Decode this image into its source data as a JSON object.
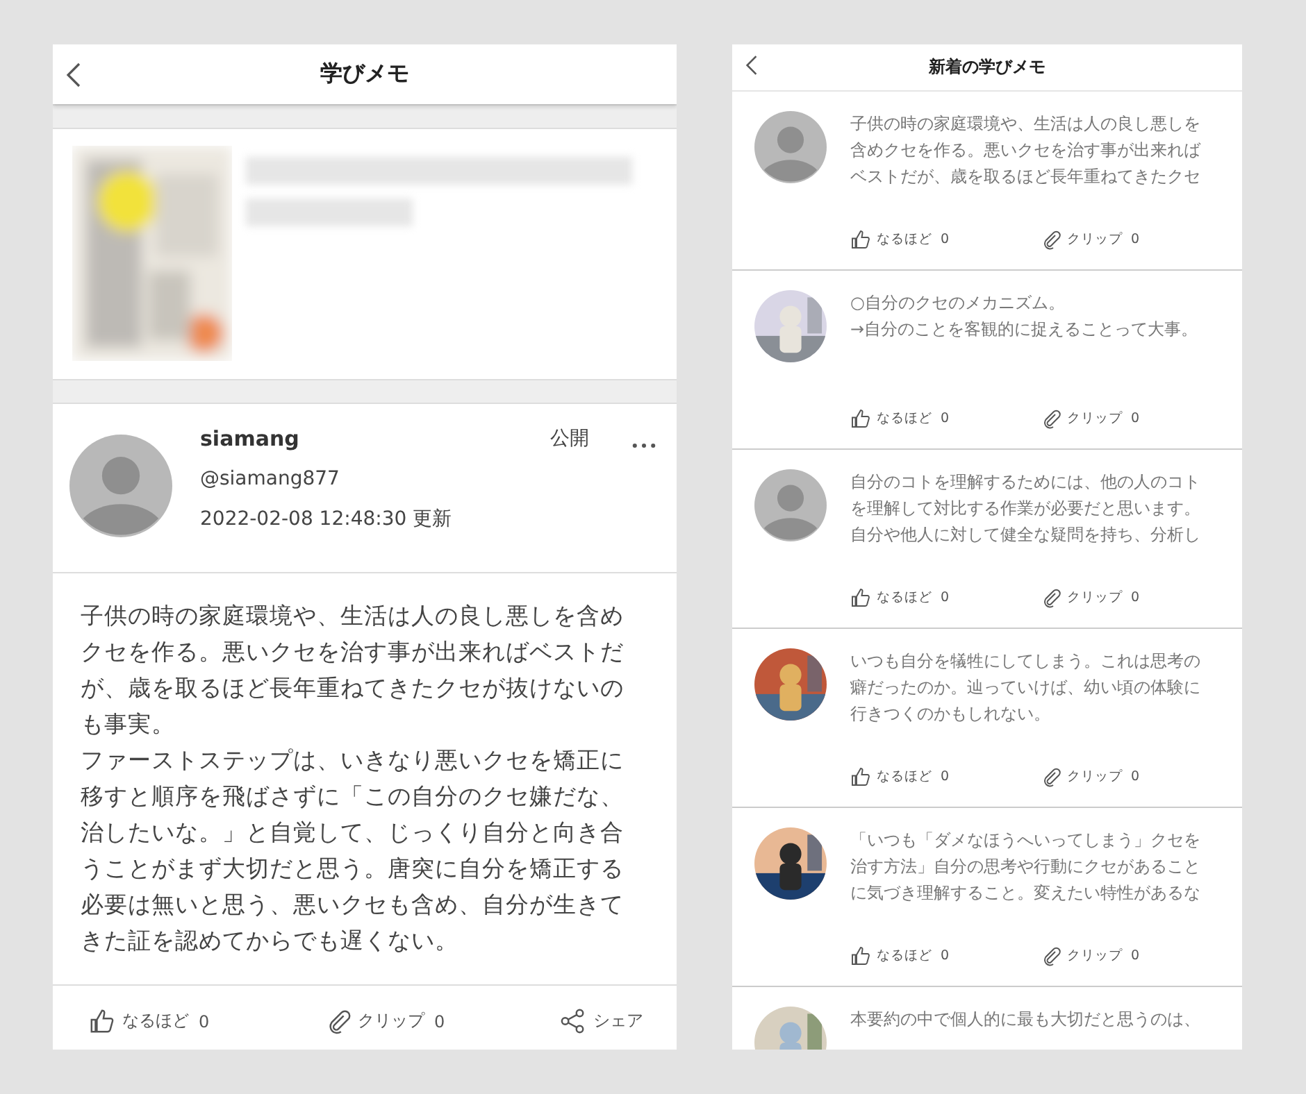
{
  "memo": {
    "title": "学びメモ",
    "author": {
      "name": "siamang",
      "handle": "@siamang877",
      "updated": "2022-02-08 12:48:30 更新",
      "visibility": "公開"
    },
    "body": [
      "子供の時の家庭環境や、生活は人の良し悪しを含めクセを作る。悪いクセを治す事が出来ればベストだが、歳を取るほど長年重ねてきたクセが抜けないのも事実。",
      "ファーストステップは、いきなり悪いクセを矯正に移すと順序を飛ばさずに「この自分のクセ嫌だな、治したいな。」と自覚して、じっくり自分と向き合うことがまず大切だと思う。唐突に自分を矯正する必要は無いと思う、悪いクセも含め、自分が生きてきた証を認めてからでも遅くない。"
    ],
    "actions": [
      {
        "kind": "like",
        "label": "なるほど",
        "count": "0"
      },
      {
        "kind": "clip",
        "label": "クリップ",
        "count": "0"
      },
      {
        "kind": "share",
        "label": "シェア"
      }
    ]
  },
  "feed": {
    "title": "新着の学びメモ",
    "items": [
      {
        "avatar": {
          "kind": "default"
        },
        "text": "子供の時の家庭環境や、生活は人の良し悪しを含めクセを作る。悪いクセを治す事が出来ればベストだが、歳を取るほど長年重ねてきたクセ",
        "actions": [
          {
            "kind": "like",
            "label": "なるほど",
            "count": "0"
          },
          {
            "kind": "clip",
            "label": "クリップ",
            "count": "0"
          }
        ]
      },
      {
        "avatar": {
          "kind": "picture"
        },
        "text": "○自分のクセのメカニズム。\n→自分のことを客観的に捉えることって大事。",
        "actions": [
          {
            "kind": "like",
            "label": "なるほど",
            "count": "0"
          },
          {
            "kind": "clip",
            "label": "クリップ",
            "count": "0"
          }
        ]
      },
      {
        "avatar": {
          "kind": "default"
        },
        "text": "自分のコトを理解するためには、他の人のコトを理解して対比する作業が必要だと思います。自分や他人に対して健全な疑問を持ち、分析し",
        "actions": [
          {
            "kind": "like",
            "label": "なるほど",
            "count": "0"
          },
          {
            "kind": "clip",
            "label": "クリップ",
            "count": "0"
          }
        ]
      },
      {
        "avatar": {
          "kind": "picture"
        },
        "text": "いつも自分を犠牲にしてしまう。これは思考の癖だったのか。辿っていけば、幼い頃の体験に行きつくのかもしれない。",
        "actions": [
          {
            "kind": "like",
            "label": "なるほど",
            "count": "0"
          },
          {
            "kind": "clip",
            "label": "クリップ",
            "count": "0"
          }
        ]
      },
      {
        "avatar": {
          "kind": "picture"
        },
        "text": "「いつも「ダメなほうへいってしまう」クセを治す方法」自分の思考や行動にクセがあることに気づき理解すること。変えたい特性があるな",
        "actions": [
          {
            "kind": "like",
            "label": "なるほど",
            "count": "0"
          },
          {
            "kind": "clip",
            "label": "クリップ",
            "count": "0"
          }
        ]
      },
      {
        "avatar": {
          "kind": "picture"
        },
        "text": "本要約の中で個人的に最も大切だと思うのは、"
      }
    ]
  }
}
